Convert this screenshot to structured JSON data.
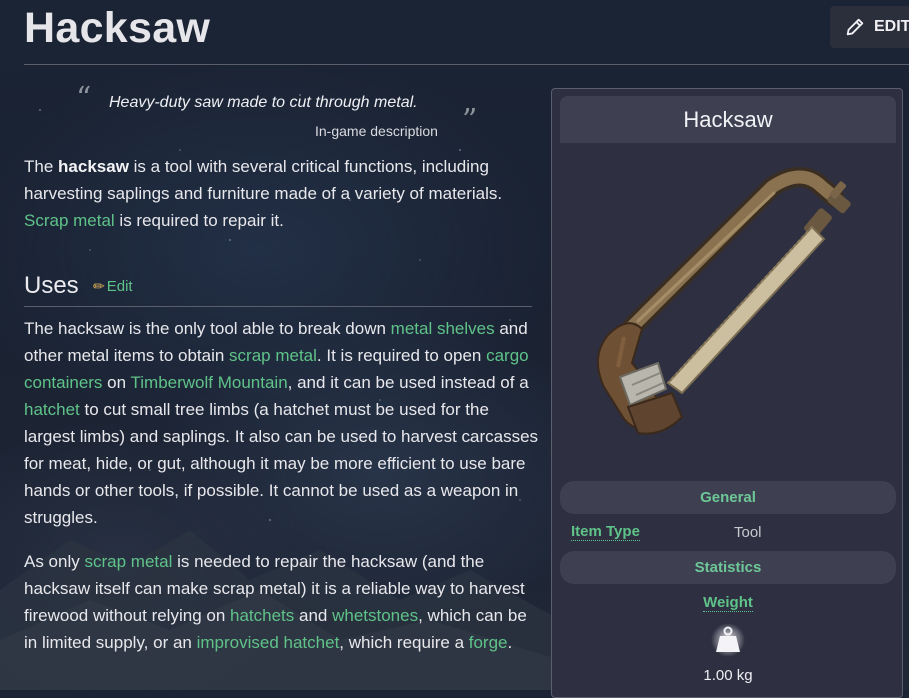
{
  "page": {
    "title": "Hacksaw",
    "edit_button": "EDIT"
  },
  "quote": {
    "text": "Heavy-duty saw made to cut through metal.",
    "source": "In-game description",
    "open_mark": "“",
    "close_mark": "”"
  },
  "intro": {
    "t1": "The ",
    "bold": "hacksaw",
    "t2": " is a tool with several critical functions, including harvesting saplings and furniture made of a variety of materials. ",
    "link_scrap": "Scrap metal",
    "t3": " is required to repair it."
  },
  "uses": {
    "heading": "Uses",
    "edit": "Edit",
    "p1": {
      "t1": "The hacksaw is the only tool able to break down ",
      "l1": "metal shelves",
      "t2": " and other metal items to obtain ",
      "l2": "scrap metal",
      "t3": ". It is required to open ",
      "l3": "cargo containers",
      "t4": " on ",
      "l4": "Timberwolf Mountain",
      "t5": ", and it can be used instead of a ",
      "l5": "hatchet",
      "t6": " to cut small tree limbs (a hatchet must be used for the largest limbs) and saplings. It also can be used to harvest carcasses for meat, hide, or gut, although it may be more efficient to use bare hands or other tools, if possible. It cannot be used as a weapon in struggles."
    },
    "p2": {
      "t1": "As only ",
      "l1": "scrap metal",
      "t2": " is needed to repair the hacksaw (and the hacksaw itself can make scrap metal) it is a reliable way to harvest firewood without relying on ",
      "l2": "hatchets",
      "t3": " and ",
      "l3": "whetstones",
      "t4": ", which can be in limited supply, or an ",
      "l4": "improvised hatchet",
      "t5": ", which require a ",
      "l5": "forge",
      "t6": "."
    }
  },
  "infobox": {
    "title": "Hacksaw",
    "general": "General",
    "item_type_label": "Item Type",
    "item_type_value": "Tool",
    "statistics": "Statistics",
    "weight_label": "Weight",
    "weight_value": "1.00 kg"
  },
  "colors": {
    "link": "#5fc389",
    "background": "#1b2434",
    "infobox_bg": "#2e2f40",
    "section_bg": "#3e4052"
  },
  "icons": [
    "pencil-icon",
    "edit-pencil-icon",
    "weight-icon"
  ]
}
